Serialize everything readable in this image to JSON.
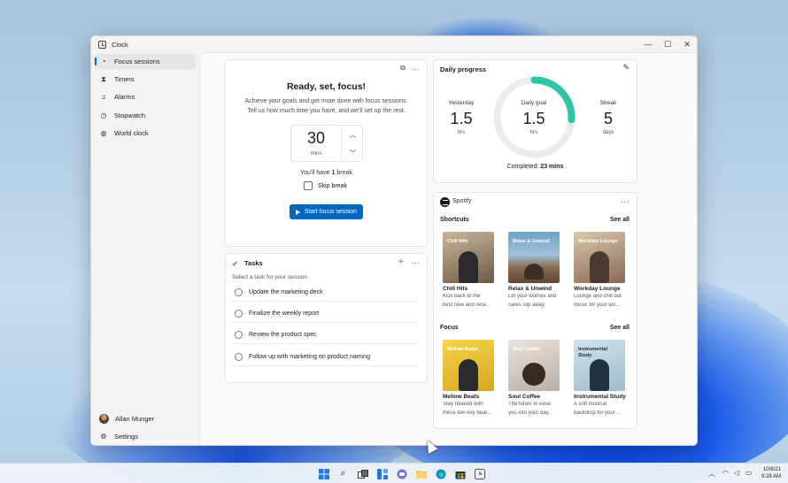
{
  "window": {
    "title": "Clock",
    "controls": {
      "minimize": "—",
      "maximize": "☐",
      "close": "✕"
    }
  },
  "sidebar": {
    "items": [
      {
        "label": "Focus sessions",
        "icon": "focus-icon",
        "active": true
      },
      {
        "label": "Timers",
        "icon": "hourglass-icon",
        "active": false
      },
      {
        "label": "Alarms",
        "icon": "bell-icon",
        "active": false
      },
      {
        "label": "Stopwatch",
        "icon": "stopwatch-icon",
        "active": false
      },
      {
        "label": "World clock",
        "icon": "globe-icon",
        "active": false
      }
    ],
    "user": "Allan Munger",
    "settings": "Settings"
  },
  "focus": {
    "title": "Ready, set, focus!",
    "description_line1": "Achieve your goals and get more done with focus sessions.",
    "description_line2": "Tell us how much time you have, and we'll set up the rest.",
    "minutes_value": "30",
    "minutes_unit": "mins",
    "break_prefix": "You'll have ",
    "break_count": "1",
    "break_suffix": " break",
    "skip_break_label": "Skip break",
    "start_label": "Start focus session"
  },
  "tasks": {
    "title": "Tasks",
    "subtitle": "Select a task for your session",
    "items": [
      "Update the marketing deck",
      "Finalize the weekly report",
      "Review the product spec",
      "Follow up with marketing on product naming"
    ]
  },
  "daily_progress": {
    "title": "Daily progress",
    "yesterday": {
      "label": "Yesterday",
      "value": "1.5",
      "unit": "hrs"
    },
    "goal": {
      "label": "Daily goal",
      "value": "1.5",
      "unit": "hrs"
    },
    "streak": {
      "label": "Streak",
      "value": "5",
      "unit": "days"
    },
    "progress_fraction": 0.26,
    "completed_prefix": "Completed: ",
    "completed_value": "23 mins",
    "accent": "#2ec4a6"
  },
  "spotify": {
    "name": "Spotify",
    "shortcuts_label": "Shortcuts",
    "focus_label": "Focus",
    "see_all": "See all",
    "shortcuts": [
      {
        "cover_text": "Chill Hits",
        "title": "Chill Hits",
        "desc1": "Kick back to the",
        "desc2": "best new and rece..."
      },
      {
        "cover_text": "Relax & Unwind",
        "title": "Relax & Unwind",
        "desc1": "Let your worries and",
        "desc2": "cares slip away."
      },
      {
        "cover_text": "Workday Lounge",
        "title": "Workday Lounge",
        "desc1": "Lounge and chill out",
        "desc2": "music for your wo..."
      }
    ],
    "focus": [
      {
        "cover_text": "Mellow Beats",
        "title": "Mellow Beats",
        "desc1": "Stay relaxed with",
        "desc2": "these low-key beat..."
      },
      {
        "cover_text": "Soul Coffee",
        "title": "Soul Coffee",
        "desc1": "The tunes to ease",
        "desc2": "you into your day."
      },
      {
        "cover_text": "Instrumental Study",
        "title": "Instrumental Study",
        "desc1": "A soft musical",
        "desc2": "backdrop for your ..."
      }
    ]
  },
  "taskbar": {
    "date": "10/6/21",
    "time": "9:28 AM"
  },
  "colors": {
    "accent_blue": "#0067c0",
    "progress_teal": "#2ec4a6"
  }
}
